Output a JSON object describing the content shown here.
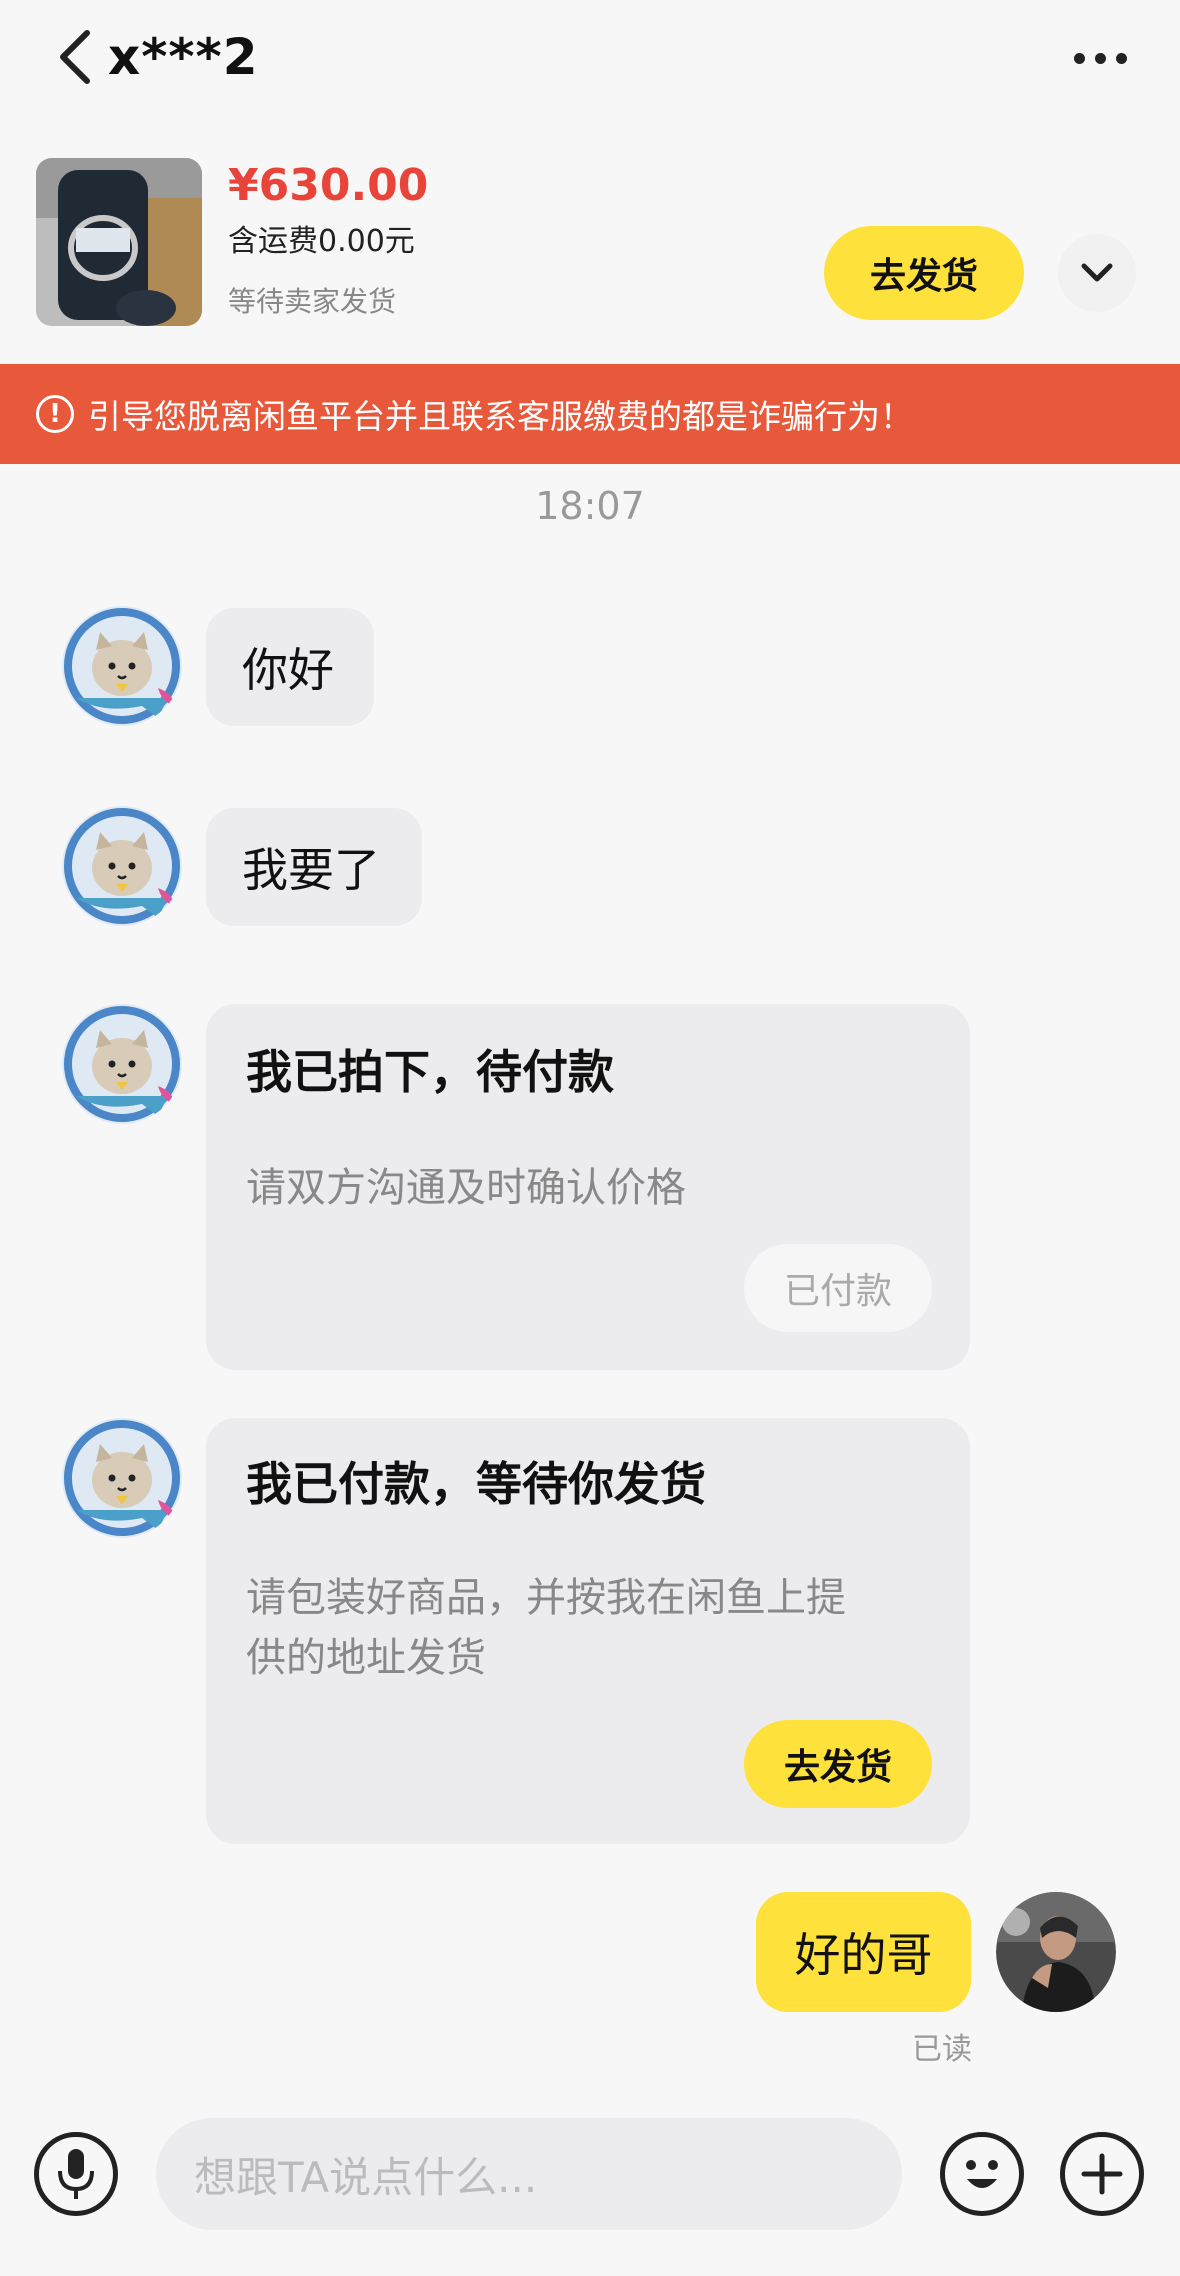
{
  "header": {
    "title": "x***2",
    "back_icon": "chevron-left-icon",
    "more_icon": "more-dots-icon"
  },
  "product": {
    "price": "¥630.00",
    "shipping": "含运费0.00元",
    "status": "等待卖家发货",
    "ship_button": "去发货"
  },
  "warning": {
    "icon": "!",
    "text": "引导您脱离闲鱼平台并且联系客服缴费的都是诈骗行为！"
  },
  "chat": {
    "time": "18:07",
    "messages": [
      {
        "text": "你好"
      },
      {
        "text": "我要了"
      }
    ],
    "card1": {
      "title": "我已拍下，待付款",
      "subtitle": "请双方沟通及时确认价格",
      "button": "已付款"
    },
    "card2": {
      "title": "我已付款，等待你发货",
      "subtitle_line1": "请包装好商品，并按我在闲鱼上提",
      "subtitle_line2": "供的地址发货",
      "button": "去发货"
    },
    "reply": "好的哥",
    "read_status": "已读"
  },
  "composer": {
    "placeholder": "想跟TA说点什么..."
  },
  "colors": {
    "accent_yellow": "#ffe13c",
    "price_red": "#e8443a",
    "warning_bg": "#e8583a"
  }
}
